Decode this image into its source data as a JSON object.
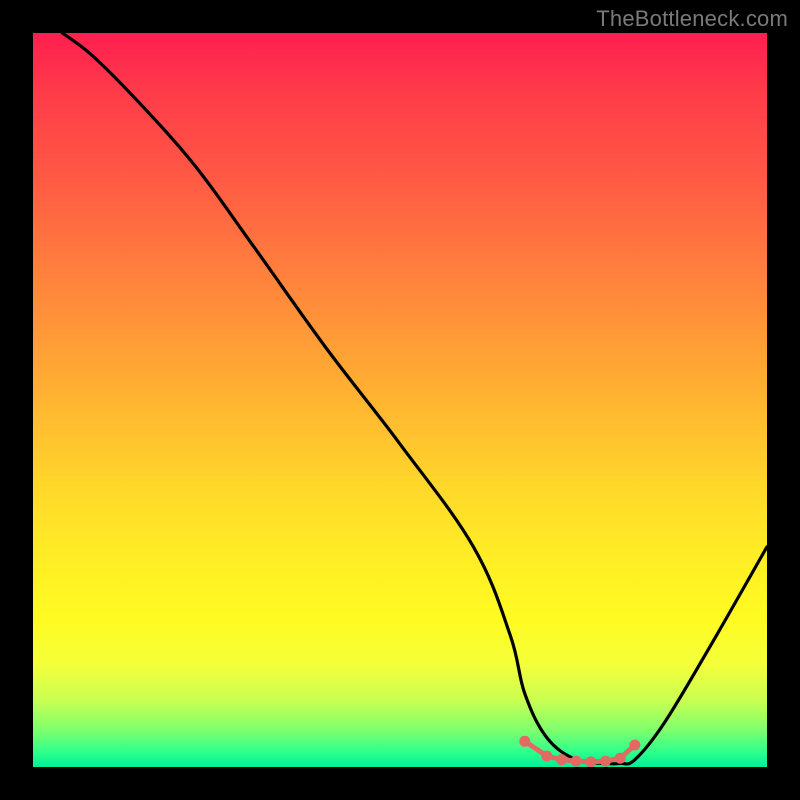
{
  "watermark": "TheBottleneck.com",
  "chart_data": {
    "type": "line",
    "title": "",
    "xlabel": "",
    "ylabel": "",
    "xlim": [
      0,
      100
    ],
    "ylim": [
      0,
      100
    ],
    "background": "rainbow-gradient-vertical",
    "series": [
      {
        "name": "bottleneck-curve",
        "color": "#000000",
        "x": [
          4,
          8,
          14,
          22,
          30,
          40,
          50,
          60,
          65,
          67,
          70,
          74,
          78,
          80,
          82,
          86,
          92,
          100
        ],
        "y": [
          100,
          97,
          91,
          82,
          71,
          57,
          44,
          30,
          18,
          10,
          4,
          1,
          0.5,
          0.5,
          1,
          6,
          16,
          30
        ]
      },
      {
        "name": "valley-markers",
        "color": "#e36a62",
        "type": "scatter",
        "x": [
          67,
          70,
          72,
          74,
          76,
          78,
          80,
          82
        ],
        "y": [
          3.5,
          1.5,
          1,
          0.8,
          0.7,
          0.8,
          1.2,
          3
        ]
      }
    ],
    "grid": false,
    "legend": false
  }
}
